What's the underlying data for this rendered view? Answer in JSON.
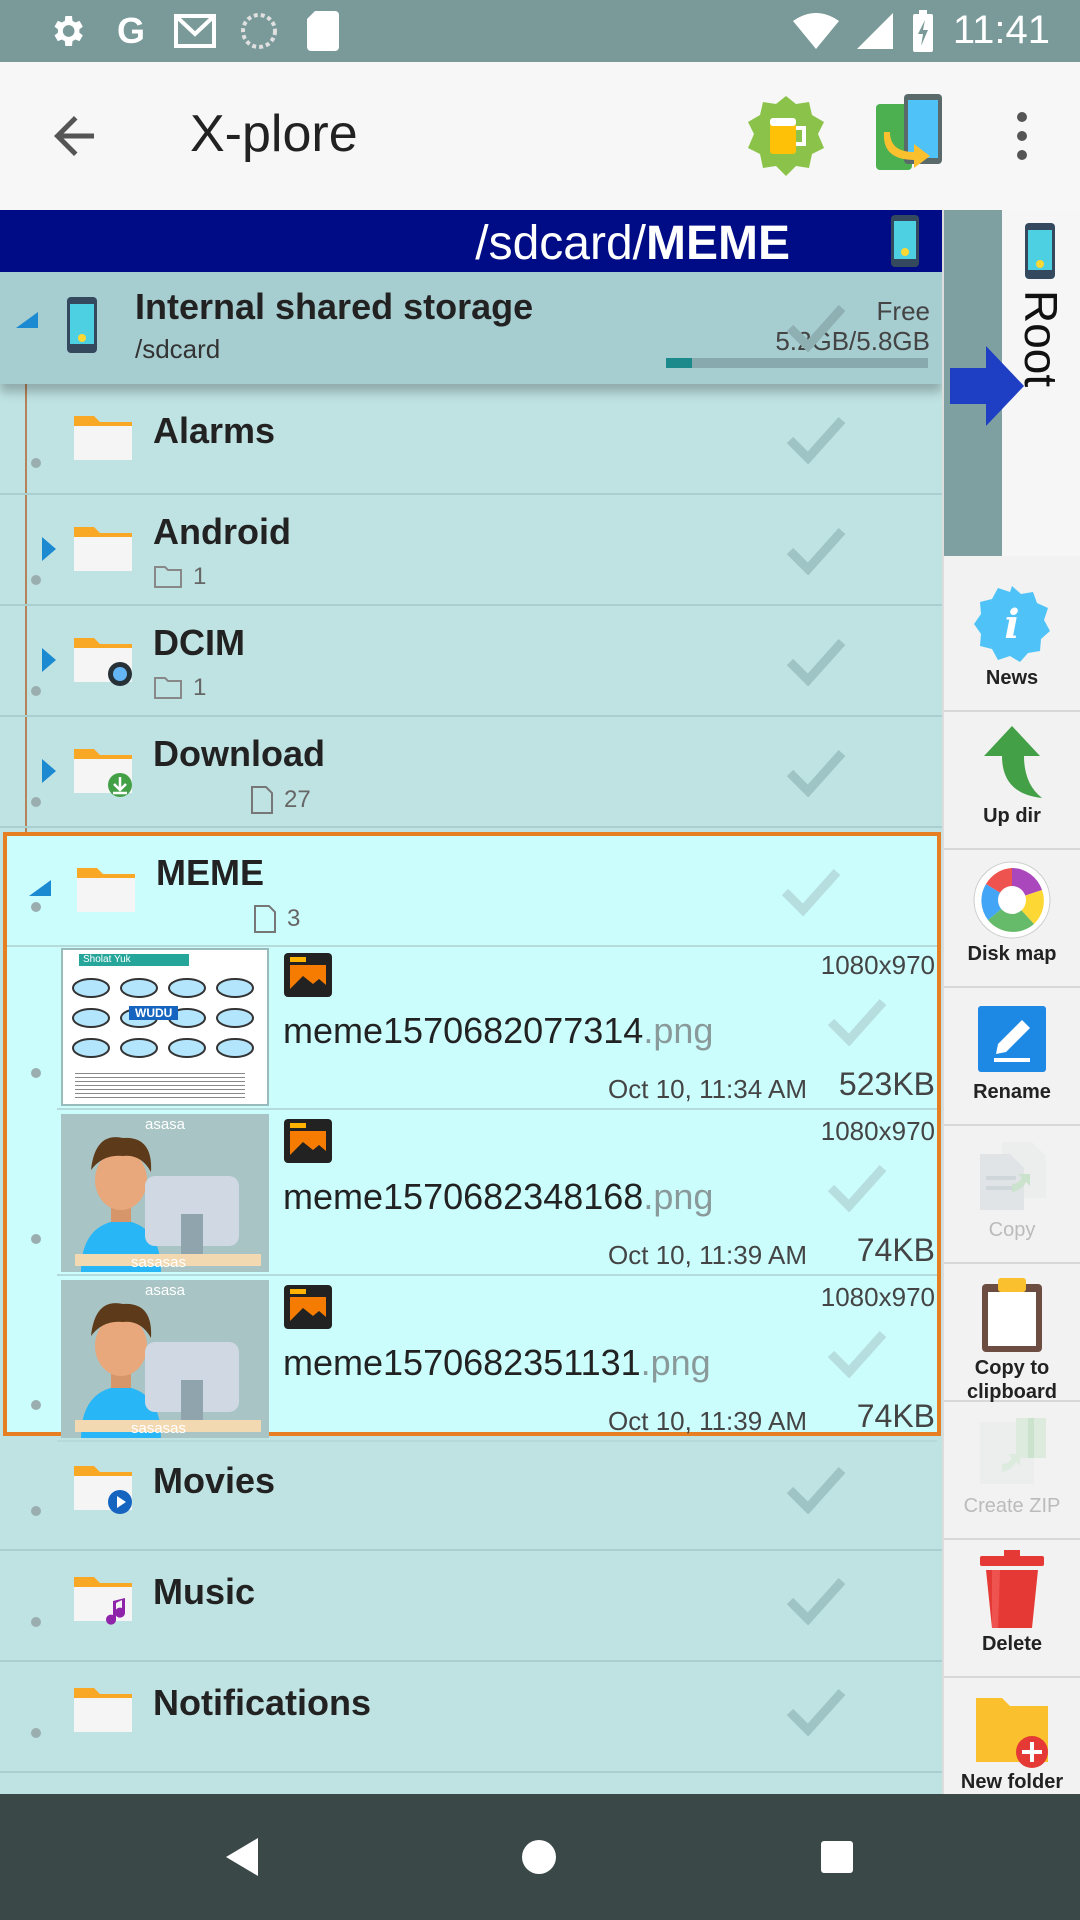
{
  "status_bar": {
    "time": "11:41",
    "icons": [
      "gear-icon",
      "google-icon",
      "gmail-icon",
      "sync-icon",
      "sdcard-icon"
    ],
    "right_icons": [
      "wifi-icon",
      "signal-icon",
      "battery-charging-icon"
    ]
  },
  "app_bar": {
    "title": "X-plore"
  },
  "path_bar": {
    "prefix": "/sdcard/",
    "current": "MEME"
  },
  "storage": {
    "name": "Internal shared storage",
    "path": "/sdcard",
    "free_label": "Free",
    "free_value": "5.2GB/5.8GB",
    "used_fraction": 0.1
  },
  "folders_top": [
    {
      "name": "Alarms",
      "sub": "",
      "expandable": false
    },
    {
      "name": "Android",
      "sub": "1",
      "sub_type": "folder",
      "expandable": true
    },
    {
      "name": "DCIM",
      "sub": "1",
      "sub_type": "folder",
      "expandable": true
    },
    {
      "name": "Download",
      "sub": "27",
      "sub_type": "file",
      "expandable": true
    }
  ],
  "meme": {
    "name": "MEME",
    "sub": "3",
    "files": [
      {
        "base": "meme1570682077314",
        "ext": ".png",
        "dim": "1080x970",
        "date": "Oct 10, 11:34 AM",
        "size": "523KB",
        "thumb_title": "Sholat Yuk",
        "thumb_word": "WUDU"
      },
      {
        "base": "meme1570682348168",
        "ext": ".png",
        "dim": "1080x970",
        "date": "Oct 10, 11:39 AM",
        "size": "74KB",
        "thumb_top": "asasa",
        "thumb_bottom": "sasasas"
      },
      {
        "base": "meme1570682351131",
        "ext": ".png",
        "dim": "1080x970",
        "date": "Oct 10, 11:39 AM",
        "size": "74KB",
        "thumb_top": "asasa",
        "thumb_bottom": "sasasas"
      }
    ]
  },
  "folders_bottom": [
    {
      "name": "Movies"
    },
    {
      "name": "Music"
    },
    {
      "name": "Notifications"
    }
  ],
  "side_panel": {
    "root_label": "Root",
    "buttons": [
      {
        "label": "News",
        "icon": "info-icon",
        "enabled": true
      },
      {
        "label": "Up dir",
        "icon": "up-arrow-icon",
        "enabled": true
      },
      {
        "label": "Disk map",
        "icon": "disk-map-icon",
        "enabled": true
      },
      {
        "label": "Rename",
        "icon": "rename-icon",
        "enabled": true
      },
      {
        "label": "Copy",
        "icon": "copy-icon",
        "enabled": false
      },
      {
        "label": "Copy to clipboard",
        "icon": "clipboard-icon",
        "enabled": true
      },
      {
        "label": "Create ZIP",
        "icon": "zip-icon",
        "enabled": false
      },
      {
        "label": "Delete",
        "icon": "trash-icon",
        "enabled": true
      },
      {
        "label": "New folder",
        "icon": "new-folder-icon",
        "enabled": true
      }
    ]
  },
  "colors": {
    "path_bar": "#000c85",
    "selection_border": "#e67e22",
    "list_bg": "#bfe3e3",
    "selected_bg": "#ccfdfd"
  }
}
